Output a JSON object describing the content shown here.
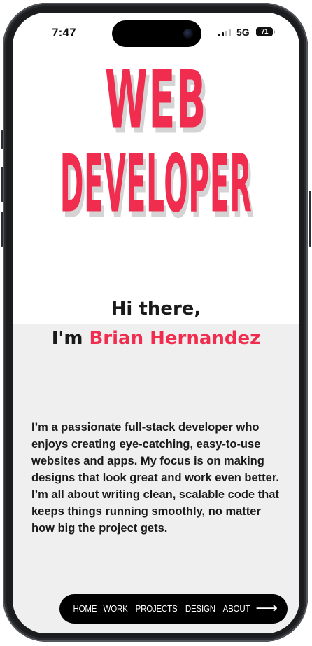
{
  "status_bar": {
    "time": "7:47",
    "network": "5G",
    "battery": "71"
  },
  "hero": {
    "line1": "WEB",
    "line2": "DEVELOPER"
  },
  "greeting": {
    "line1": "Hi there,",
    "prefix": "I'm ",
    "name": "Brian Hernandez"
  },
  "bio": "I’m a passionate full-stack developer who enjoys creating eye-catching, easy-to-use websites and apps. My focus is on making designs that look great and work even better. I’m all about writing clean, scalable code that keeps things running smoothly, no matter how big the project gets.",
  "nav": {
    "items": [
      "HOME",
      "WORK",
      "PROJECTS",
      "DESIGN",
      "ABOUT"
    ],
    "arrow_icon": "arrow-right-icon"
  },
  "colors": {
    "accent": "#f02d4e",
    "text": "#1a1a1a",
    "band": "#efefef",
    "nav_bg": "#000000"
  }
}
